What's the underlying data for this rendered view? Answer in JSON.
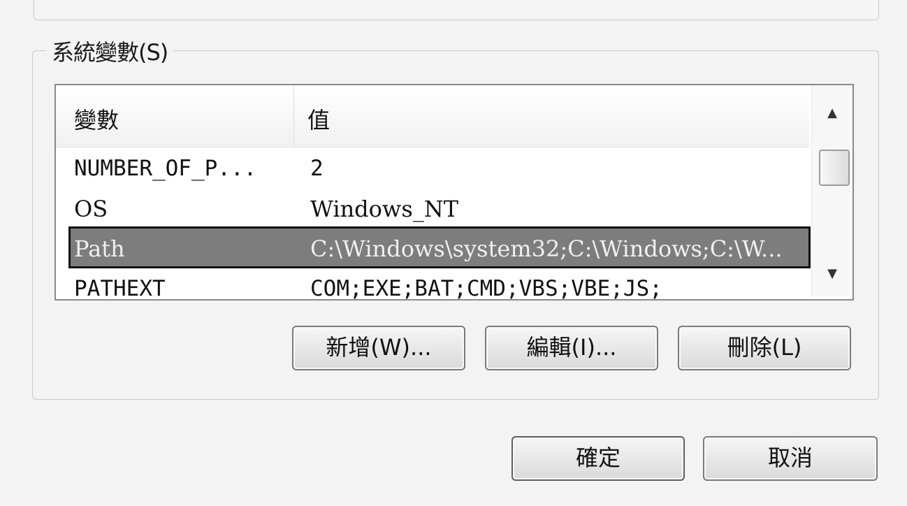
{
  "group": {
    "title": "系統變數(S)"
  },
  "list": {
    "columns": {
      "variable": "變數",
      "value": "值"
    },
    "rows": [
      {
        "variable": "NUMBER_OF_P...",
        "value": "2"
      },
      {
        "variable": "OS",
        "value": "Windows_NT"
      },
      {
        "variable": "Path",
        "value": "C:\\Windows\\system32;C:\\Windows;C:\\W..."
      },
      {
        "variable": "PATHEXT",
        "value": "COM;EXE;BAT;CMD;VBS;VBE;JS;"
      }
    ],
    "selected_row": 2
  },
  "buttons": {
    "new": "新增(W)...",
    "edit": "編輯(I)...",
    "delete": "刪除(L)",
    "ok": "確定",
    "cancel": "取消"
  },
  "scrollbar": {
    "up_icon": "chevron-up-icon",
    "down_icon": "chevron-down-icon"
  }
}
